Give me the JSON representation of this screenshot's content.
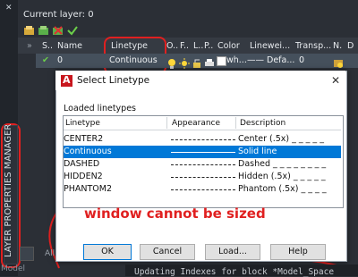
{
  "palette": {
    "title": "LAYER PROPERTIES MANAGER",
    "close_glyph": "✕",
    "model_label": "Model"
  },
  "header": {
    "current_layer": "Current layer: 0",
    "columns": {
      "name": "Name",
      "linetype": "Linetype",
      "o": "O..",
      "f": "F..",
      "l": "L..",
      "p": "P..",
      "color": "Color",
      "lineweight": "Linewei...",
      "transparency": "Transp...",
      "n": "N.",
      "d": "D"
    }
  },
  "row": {
    "status": "✔",
    "name": "0",
    "linetype": "Continuous",
    "color": "wh...",
    "lineweight": "—— Defa...",
    "transparency": "0"
  },
  "dialog": {
    "title": "Select Linetype",
    "close": "✕",
    "loaded_label": "Loaded linetypes",
    "columns": {
      "linetype": "Linetype",
      "appearance": "Appearance",
      "description": "Description"
    },
    "items": [
      {
        "name": "CENTER2",
        "desc": "Center (.5x) _ _ _ _ _"
      },
      {
        "name": "Continuous",
        "desc": "Solid line"
      },
      {
        "name": "DASHED",
        "desc": "Dashed _ _ _ _ _ _ _ _"
      },
      {
        "name": "HIDDEN2",
        "desc": "Hidden (.5x) _ _ _ _ _"
      },
      {
        "name": "PHANTOM2",
        "desc": "Phantom (.5x) _ _ _ _"
      }
    ],
    "buttons": {
      "ok": "OK",
      "cancel": "Cancel",
      "load": "Load...",
      "help": "Help"
    }
  },
  "annotation": "window cannot be sized",
  "behind": {
    "all_label": "All"
  },
  "command_line": "Updating Indexes for block *Model_Space",
  "colors": {
    "accent_red": "#e02020",
    "selection": "#0078d7"
  }
}
